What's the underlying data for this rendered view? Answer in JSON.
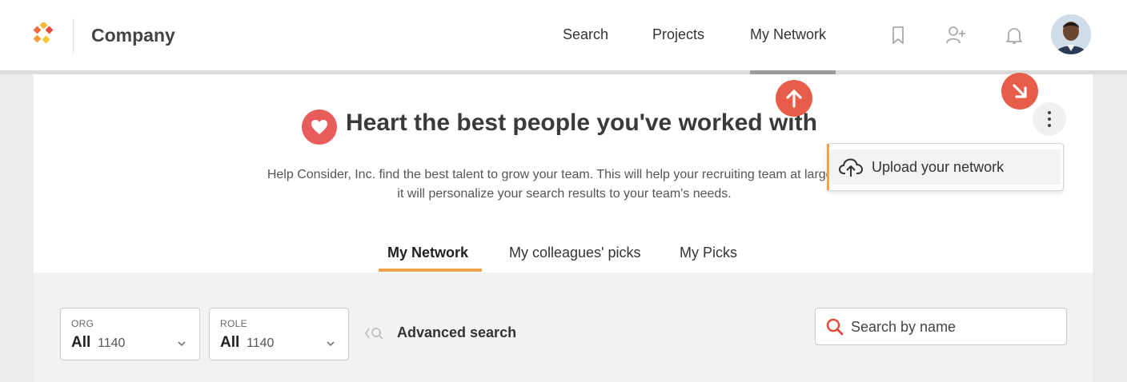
{
  "header": {
    "company_name": "Company",
    "nav": [
      {
        "label": "Search"
      },
      {
        "label": "Projects"
      },
      {
        "label": "My Network",
        "active": true
      }
    ],
    "icons": [
      "bookmark-icon",
      "add-user-icon",
      "bell-icon",
      "avatar"
    ]
  },
  "hero": {
    "title": "Heart the best people you've worked with",
    "description": "Help Consider, Inc. find the best talent to grow your team. This will help your recruiting team at large, and it will personalize your search results to your team's needs."
  },
  "menu": {
    "items": [
      {
        "label": "Upload your network",
        "icon": "cloud-upload-icon"
      }
    ]
  },
  "tabs": [
    {
      "label": "My Network",
      "active": true
    },
    {
      "label": "My colleagues' picks"
    },
    {
      "label": "My Picks"
    }
  ],
  "filters": {
    "org": {
      "label": "ORG",
      "value": "All",
      "count": "1140"
    },
    "role": {
      "label": "ROLE",
      "value": "All",
      "count": "1140"
    },
    "advanced_search_label": "Advanced search",
    "search_placeholder": "Search by name"
  },
  "colors": {
    "accent": "#f2a24a",
    "marker": "#e85c4a",
    "heart": "#e85c5c"
  }
}
